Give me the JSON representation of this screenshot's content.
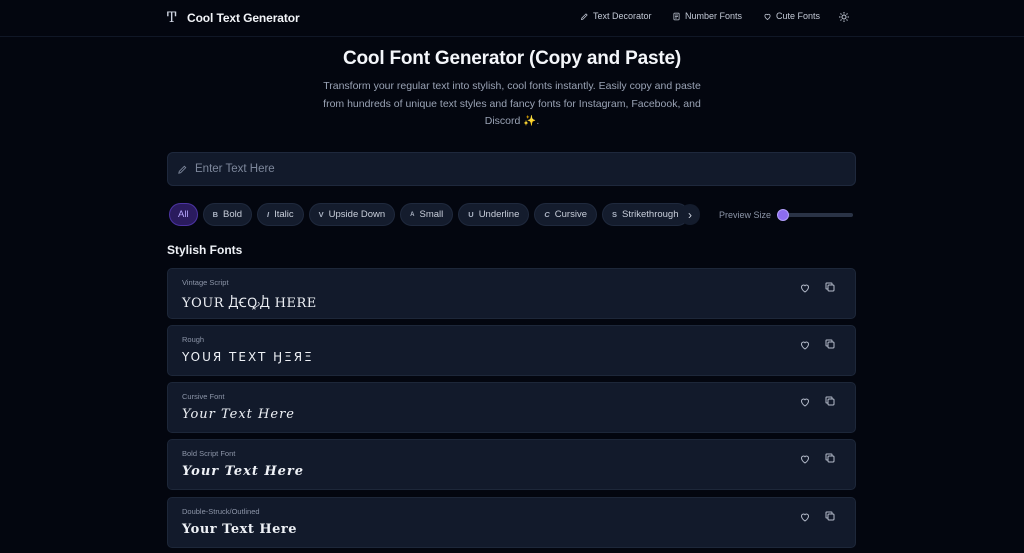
{
  "header": {
    "brand": "Cool Text Generator",
    "nav": [
      {
        "label": "Text Decorator",
        "icon": "pencil-icon"
      },
      {
        "label": "Number Fonts",
        "icon": "document-icon"
      },
      {
        "label": "Cute Fonts",
        "icon": "heart-icon"
      }
    ],
    "theme_icon": "sun-icon"
  },
  "hero": {
    "title": "Cool Font Generator (Copy and Paste)",
    "description": "Transform your regular text into stylish, cool fonts instantly. Easily copy and paste from hundreds of unique text styles and fancy fonts for Instagram, Facebook, and Discord ✨."
  },
  "input": {
    "placeholder": "Enter Text Here",
    "value": ""
  },
  "filters": [
    {
      "label": "All",
      "icon": "",
      "active": true
    },
    {
      "label": "Bold",
      "icon": "B",
      "active": false
    },
    {
      "label": "Italic",
      "icon": "I",
      "active": false
    },
    {
      "label": "Upside Down",
      "icon": "V",
      "active": false
    },
    {
      "label": "Small",
      "icon": "A",
      "active": false
    },
    {
      "label": "Underline",
      "icon": "U",
      "active": false
    },
    {
      "label": "Cursive",
      "icon": "C",
      "active": false
    },
    {
      "label": "Strikethrough",
      "icon": "S",
      "active": false
    }
  ],
  "preview": {
    "label": "Preview Size",
    "value_fraction": 0.0
  },
  "section_title": "Stylish Fonts",
  "fonts": [
    {
      "name": "Vintage Script",
      "sample": "YOUR ꚀꞒꝘꚀ HERE"
    },
    {
      "name": "Rough",
      "sample": "YOUЯ TEXT ӇΞЯΞ"
    },
    {
      "name": "Cursive Font",
      "sample": "Your Text Here"
    },
    {
      "name": "Bold Script Font",
      "sample": "Your Text Here"
    },
    {
      "name": "Double-Struck/Outlined",
      "sample": "Your Text Here"
    }
  ],
  "colors": {
    "background": "#03060f",
    "card": "#121a2b",
    "accent": "#8d6df0"
  }
}
